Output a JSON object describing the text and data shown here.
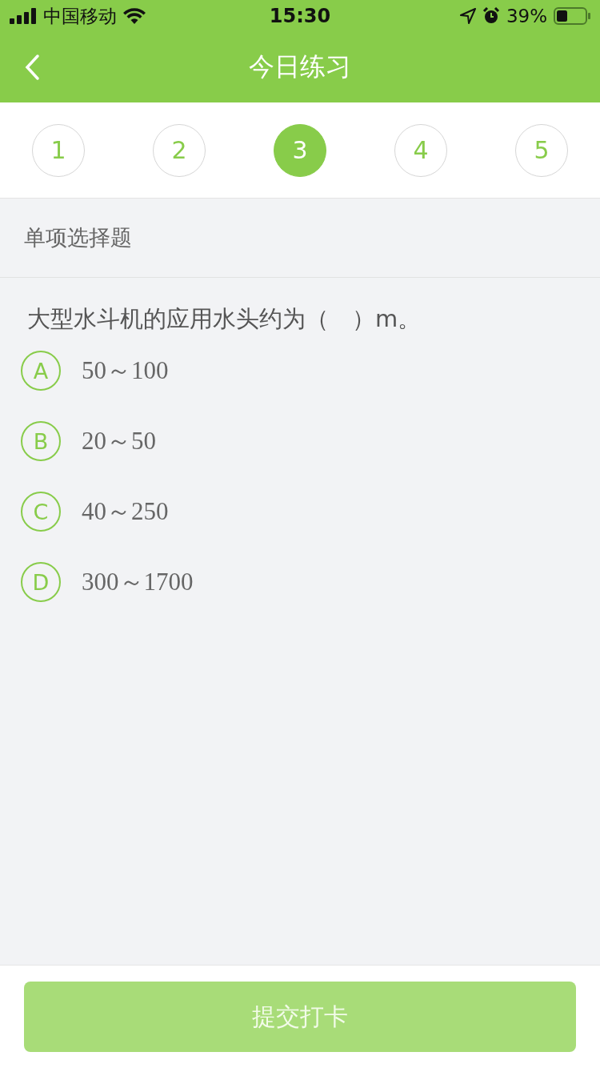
{
  "status_bar": {
    "carrier": "中国移动",
    "time": "15:30",
    "battery": "39%"
  },
  "header": {
    "title": "今日练习"
  },
  "steps": [
    {
      "label": "1",
      "selected": false
    },
    {
      "label": "2",
      "selected": false
    },
    {
      "label": "3",
      "selected": true
    },
    {
      "label": "4",
      "selected": false
    },
    {
      "label": "5",
      "selected": false
    }
  ],
  "section_title": "单项选择题",
  "question": "大型水斗机的应用水头约为（　）m。",
  "options": [
    {
      "letter": "A",
      "text": "50～100",
      "selected": false
    },
    {
      "letter": "B",
      "text": "20～50",
      "selected": false
    },
    {
      "letter": "C",
      "text": "40～250",
      "selected": false
    },
    {
      "letter": "D",
      "text": "300～1700",
      "selected": false
    }
  ],
  "submit": {
    "label": "提交打卡",
    "disabled": true
  }
}
